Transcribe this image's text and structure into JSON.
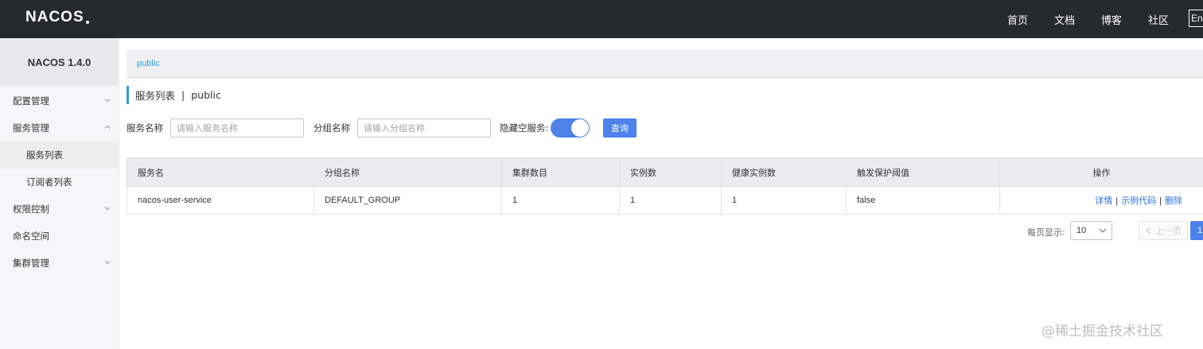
{
  "header": {
    "logo": "NACOS",
    "nav": [
      "首页",
      "文档",
      "博客",
      "社区"
    ],
    "lang": "En"
  },
  "sidebar": {
    "title": "NACOS 1.4.0",
    "items": [
      {
        "label": "配置管理"
      },
      {
        "label": "服务管理"
      },
      {
        "label": "服务列表"
      },
      {
        "label": "订阅者列表"
      },
      {
        "label": "权限控制"
      },
      {
        "label": "命名空间"
      },
      {
        "label": "集群管理"
      }
    ]
  },
  "main": {
    "namespace_crumb": "public",
    "page_title": "服务列表",
    "title_sep": "|",
    "title_namespace": "public",
    "filters": {
      "service_name_label": "服务名称",
      "service_name_placeholder": "请输入服务名称",
      "group_name_label": "分组名称",
      "group_name_placeholder": "请输入分组名称",
      "hide_empty_label": "隐藏空服务:",
      "hide_empty_on": true,
      "query_label": "查询"
    },
    "table": {
      "headers": [
        "服务名",
        "分组名称",
        "集群数目",
        "实例数",
        "健康实例数",
        "触发保护阈值",
        "操作"
      ],
      "rows": [
        {
          "service": "nacos-user-service",
          "group": "DEFAULT_GROUP",
          "clusters": "1",
          "instances": "1",
          "healthy": "1",
          "threshold": "false",
          "actions": [
            "详情",
            "示例代码",
            "删除"
          ]
        }
      ]
    },
    "pagination": {
      "per_page_label": "每页显示:",
      "per_page_value": "10",
      "prev_label": "上一页",
      "current_page": "1"
    }
  },
  "watermark": "@稀土掘金技术社区",
  "colors": {
    "header_bg": "#252a2f",
    "accent": "#4d82ea",
    "link": "#2a6fdc",
    "crumb_link": "#2e9bd0"
  }
}
